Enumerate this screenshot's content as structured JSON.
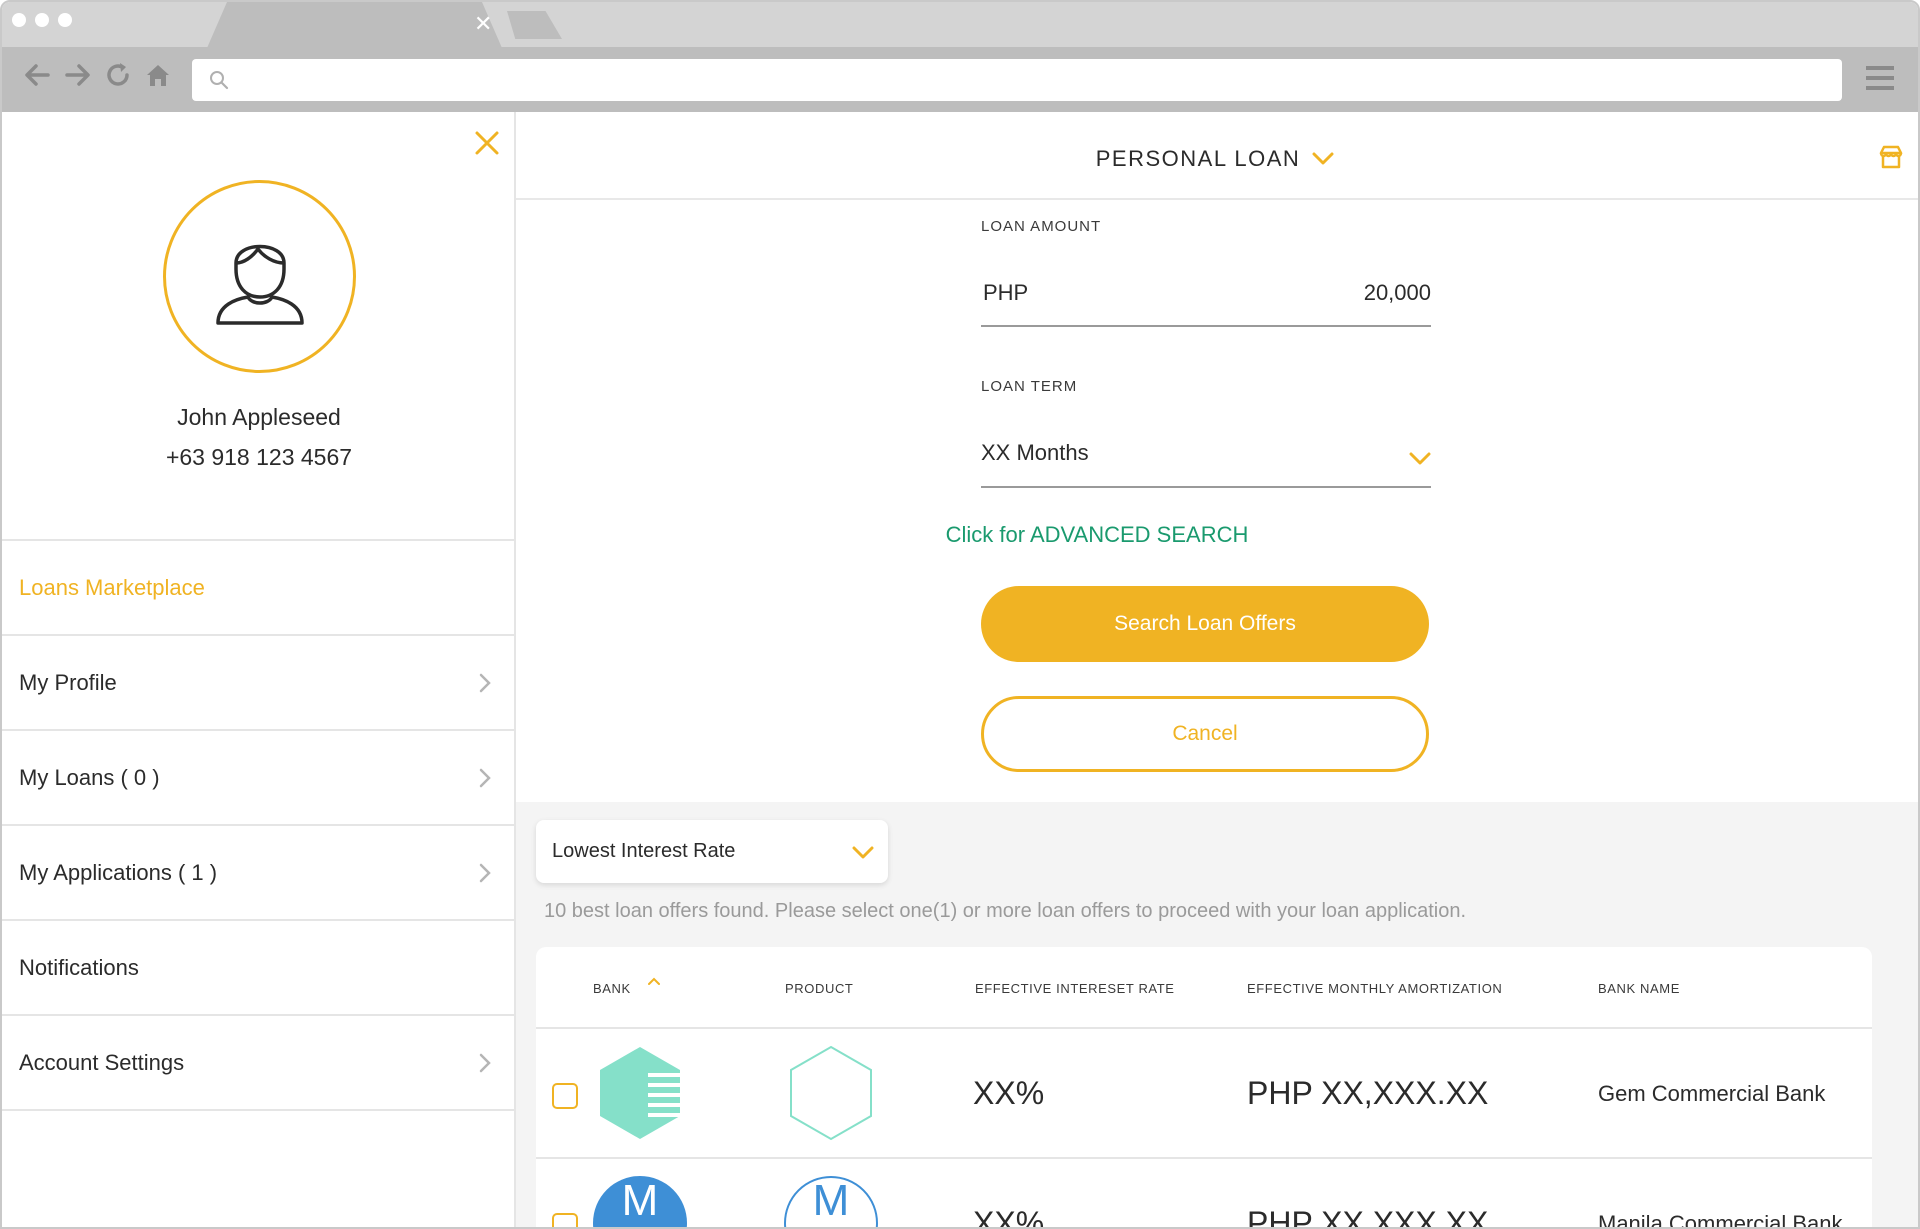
{
  "browser": {
    "address_placeholder": ""
  },
  "sidebar": {
    "user": {
      "name": "John Appleseed",
      "phone": "+63   918 123 4567"
    },
    "items": [
      {
        "label": "Loans Marketplace",
        "active": true,
        "chevron": false
      },
      {
        "label": "My Profile",
        "active": false,
        "chevron": true
      },
      {
        "label": "My Loans ( 0 )",
        "active": false,
        "chevron": true
      },
      {
        "label": "My Applications ( 1 )",
        "active": false,
        "chevron": true
      },
      {
        "label": "Notifications",
        "active": false,
        "chevron": false
      },
      {
        "label": "Account Settings",
        "active": false,
        "chevron": true
      }
    ]
  },
  "main": {
    "loan_type": "PERSONAL LOAN",
    "form": {
      "amount_label": "LOAN AMOUNT",
      "amount_currency": "PHP",
      "amount_value": "20,000",
      "term_label": "LOAN TERM",
      "term_value": "XX Months",
      "advanced_link": "Click for ADVANCED SEARCH",
      "search_button": "Search Loan Offers",
      "cancel_button": "Cancel"
    },
    "results": {
      "sort_value": "Lowest Interest Rate",
      "message": "10 best loan offers found. Please select one(1) or more loan offers to proceed with your loan application.",
      "columns": [
        "BANK",
        "PRODUCT",
        "EFFECTIVE INTERESET RATE",
        "EFFECTIVE MONTHLY AMORTIZATION",
        "BANK NAME"
      ],
      "rows": [
        {
          "bank_logo": "hexagon-lines-icon",
          "product_icon": "hexagon-outline-icon",
          "rate": "XX%",
          "amortization": "PHP XX,XXX.XX",
          "bank_name": "Gem Commercial Bank"
        },
        {
          "bank_logo": "circle-m-icon",
          "bank_logo_text": "M",
          "product_icon": "circle-m-outline-icon",
          "product_icon_text": "M",
          "rate": "XX%",
          "amortization": "PHP XX,XXX.XX",
          "bank_name": "Manila Commercial Bank"
        }
      ]
    }
  },
  "colors": {
    "accent": "#f0b323",
    "link": "#1a9a6e",
    "gem_logo": "#85e0c9",
    "manila_logo": "#3e8fd6"
  }
}
